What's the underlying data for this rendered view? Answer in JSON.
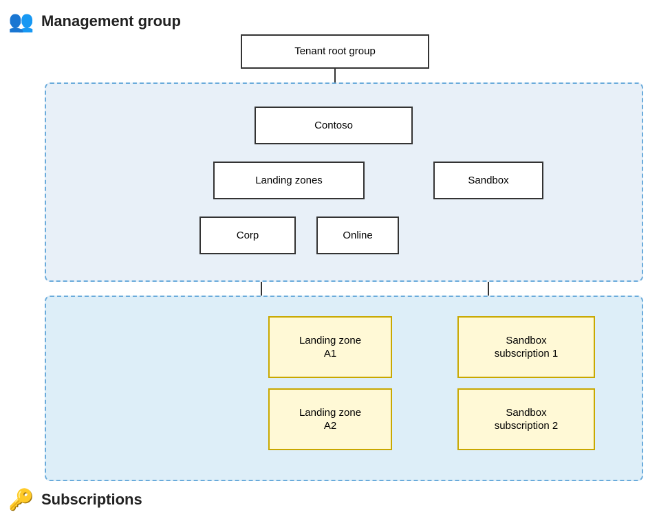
{
  "header": {
    "mgmt_label": "Management group",
    "sub_label": "Subscriptions"
  },
  "nodes": {
    "tenant_root": "Tenant root group",
    "contoso": "Contoso",
    "landing_zones": "Landing zones",
    "sandbox": "Sandbox",
    "corp": "Corp",
    "online": "Online",
    "landing_zone_a1_line1": "Landing zone",
    "landing_zone_a1_line2": "A1",
    "landing_zone_a2_line1": "Landing zone",
    "landing_zone_a2_line2": "A2",
    "sandbox_sub1_line1": "Sandbox",
    "sandbox_sub1_line2": "subscription 1",
    "sandbox_sub2_line1": "Sandbox",
    "sandbox_sub2_line2": "subscription 2"
  },
  "icons": {
    "people": "👥",
    "key": "🔑"
  }
}
